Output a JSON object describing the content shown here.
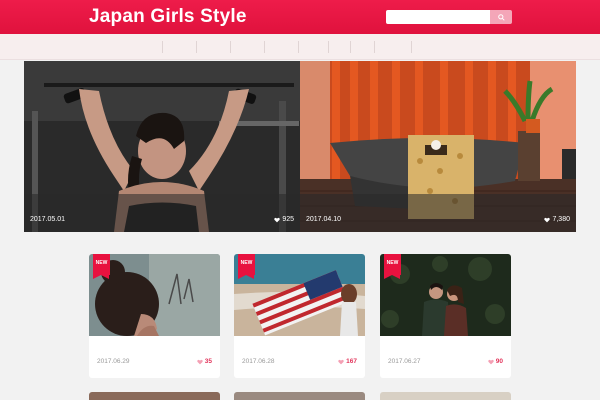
{
  "site": {
    "title": "Japan Girls Style"
  },
  "search": {
    "placeholder": ""
  },
  "nav": {
    "items": [
      "",
      "",
      "",
      "",
      "",
      "",
      "",
      ""
    ]
  },
  "hero": [
    {
      "date": "2017.05.01",
      "likes": "925"
    },
    {
      "date": "2017.04.10",
      "likes": "7,380"
    }
  ],
  "cards": [
    {
      "badge": "NEW",
      "date": "2017.06.29",
      "likes": "35"
    },
    {
      "badge": "NEW",
      "date": "2017.06.28",
      "likes": "167"
    },
    {
      "badge": "NEW",
      "date": "2017.06.27",
      "likes": "90"
    }
  ],
  "colors": {
    "brand": "#e8123f",
    "nav_bg": "#f7eeee",
    "page_bg": "#f2f2f2",
    "like": "#e2335a"
  },
  "icons": {
    "search": "search-icon",
    "like": "heart-icon"
  }
}
